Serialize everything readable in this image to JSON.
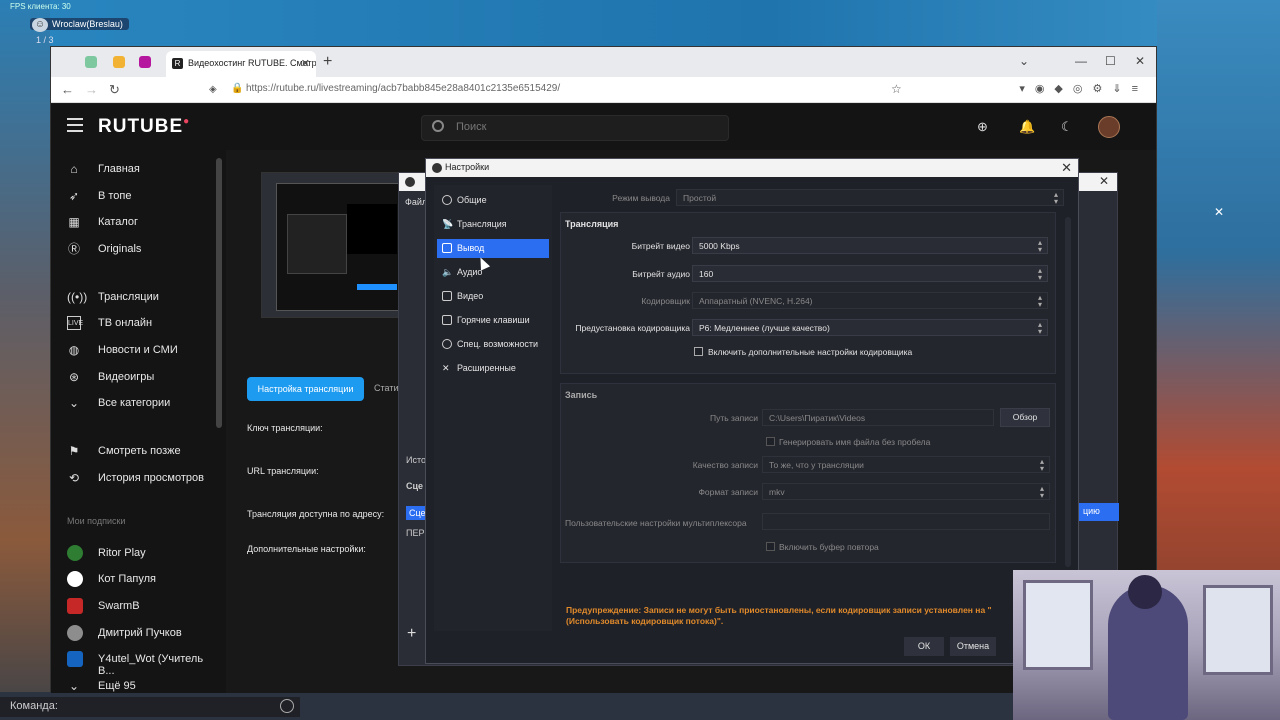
{
  "overlay": {
    "fps": "FPS клиента: 30",
    "location": "Wroclaw(Breslau)",
    "page": "1 / 3",
    "command_label": "Команда:"
  },
  "browser": {
    "tab_title": "Видеохостинг RUTUBE. Смотр...",
    "url": "https://rutube.ru/livestreaming/acb7babb845e28a8401c2135e6515429/"
  },
  "rutube": {
    "logo": "RUTUBE",
    "search_placeholder": "Поиск",
    "sidebar": {
      "items": [
        {
          "label": "Главная",
          "icon": "home-icon"
        },
        {
          "label": "В топе",
          "icon": "rocket-icon"
        },
        {
          "label": "Каталог",
          "icon": "grid-icon"
        },
        {
          "label": "Originals",
          "icon": "originals-icon"
        },
        {
          "label": "Трансляции",
          "icon": "broadcast-icon"
        },
        {
          "label": "ТВ онлайн",
          "icon": "live-icon"
        },
        {
          "label": "Новости и СМИ",
          "icon": "globe-icon"
        },
        {
          "label": "Видеоигры",
          "icon": "gamepad-icon"
        },
        {
          "label": "Все категории",
          "icon": "chevron-down-icon"
        },
        {
          "label": "Смотреть позже",
          "icon": "bookmark-icon"
        },
        {
          "label": "История просмотров",
          "icon": "history-icon"
        }
      ],
      "subscriptions_title": "Мои подписки",
      "subscriptions": [
        {
          "label": "Ritor Play",
          "color": "#2e7d32"
        },
        {
          "label": "Кот Папуля",
          "color": "#ffffff"
        },
        {
          "label": "SwarmB",
          "color": "#c62828"
        },
        {
          "label": "Дмитрий Пучков",
          "color": "#8d8d8d"
        },
        {
          "label": "Y4utel_Wot (Учитель В...",
          "color": "#1565c0"
        }
      ],
      "more": "Ещё 95"
    },
    "stream": {
      "setup_button": "Настройка трансляции",
      "stats_tab": "Стати",
      "labels": {
        "key": "Ключ трансляции:",
        "url": "URL трансляции:",
        "available": "Трансляция доступна по адресу:",
        "extra": "Дополнительные настройки:"
      }
    }
  },
  "obs_main": {
    "file_menu": "Файл",
    "sources_label": "Исто",
    "scenes_label": "Сце",
    "scene_item": "Сцен",
    "transition": "ПЕР",
    "right_button": "цию"
  },
  "settings": {
    "title": "Настройки",
    "nav": [
      {
        "label": "Общие",
        "active": false
      },
      {
        "label": "Трансляция",
        "active": false
      },
      {
        "label": "Вывод",
        "active": true
      },
      {
        "label": "Аудио",
        "active": false
      },
      {
        "label": "Видео",
        "active": false
      },
      {
        "label": "Горячие клавиши",
        "active": false
      },
      {
        "label": "Спец. возможности",
        "active": false
      },
      {
        "label": "Расширенные",
        "active": false
      }
    ],
    "output_mode_label": "Режим вывода",
    "output_mode_value": "Простой",
    "streaming": {
      "title": "Трансляция",
      "video_bitrate_label": "Битрейт видео",
      "video_bitrate_value": "5000 Kbps",
      "audio_bitrate_label": "Битрейт аудио",
      "audio_bitrate_value": "160",
      "encoder_label": "Кодировщик",
      "encoder_value": "Аппаратный (NVENC, H.264)",
      "preset_label": "Предустановка кодировщика",
      "preset_value": "P6: Медленнее (лучше качество)",
      "advanced_checkbox": "Включить дополнительные настройки кодировщика"
    },
    "recording": {
      "title": "Запись",
      "path_label": "Путь записи",
      "path_value": "C:\\Users\\Пиратик\\Videos",
      "browse_button": "Обзор",
      "no_space_checkbox": "Генерировать имя файла без пробела",
      "quality_label": "Качество записи",
      "quality_value": "То же, что у трансляции",
      "format_label": "Формат записи",
      "format_value": "mkv",
      "muxer_label": "Пользовательские настройки мультиплексора",
      "replay_checkbox": "Включить буфер повтора"
    },
    "warning": "Предупреждение: Записи не могут быть приостановлены, если кодировщик записи установлен на \"(Использовать кодировщик потока)\".",
    "ok": "ОК",
    "cancel": "Отмена"
  }
}
